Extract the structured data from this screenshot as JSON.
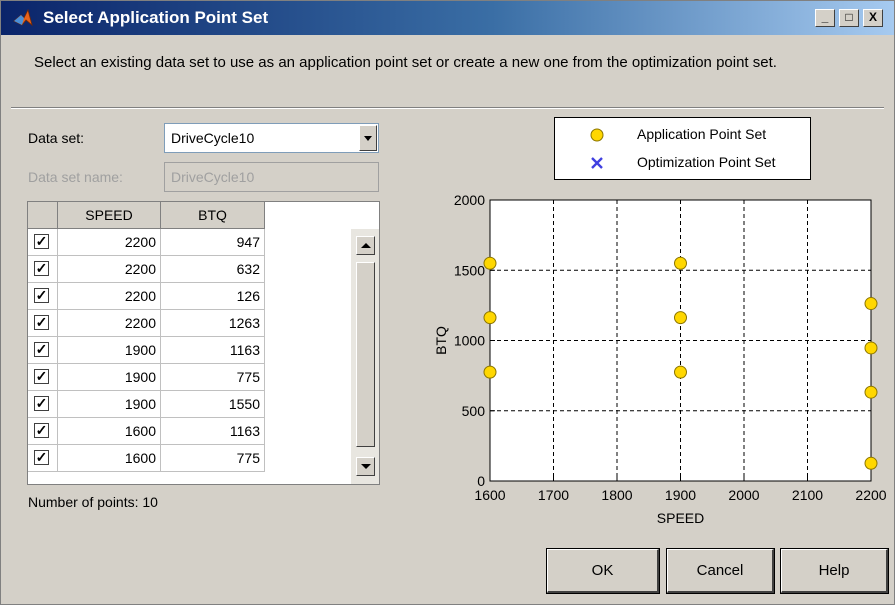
{
  "window": {
    "title": "Select Application Point Set",
    "minimize": "_",
    "maximize": "□",
    "close": "X"
  },
  "description": "Select an existing data set to use as an application point set or create a new one from the optimization point set.",
  "form": {
    "data_set_label": "Data set:",
    "data_set_value": "DriveCycle10",
    "name_label": "Data set name:",
    "name_value": "DriveCycle10"
  },
  "table": {
    "columns": [
      "SPEED",
      "BTQ"
    ],
    "rows": [
      {
        "checked": true,
        "speed": "2200",
        "btq": "947"
      },
      {
        "checked": true,
        "speed": "2200",
        "btq": "632"
      },
      {
        "checked": true,
        "speed": "2200",
        "btq": "126"
      },
      {
        "checked": true,
        "speed": "2200",
        "btq": "1263"
      },
      {
        "checked": true,
        "speed": "1900",
        "btq": "1163"
      },
      {
        "checked": true,
        "speed": "1900",
        "btq": "775"
      },
      {
        "checked": true,
        "speed": "1900",
        "btq": "1550"
      },
      {
        "checked": true,
        "speed": "1600",
        "btq": "1163"
      },
      {
        "checked": true,
        "speed": "1600",
        "btq": "775"
      }
    ]
  },
  "num_points": "Number of points: 10",
  "colors": {
    "marker_fill": "#ffd700",
    "marker_stroke": "#8b7500",
    "cross": "#4040e0"
  },
  "chart_data": {
    "type": "scatter",
    "xlabel": "SPEED",
    "ylabel": "BTQ",
    "xlim": [
      1600,
      2200
    ],
    "ylim": [
      0,
      2000
    ],
    "xticks": [
      1600,
      1700,
      1800,
      1900,
      2000,
      2100,
      2200
    ],
    "yticks": [
      0,
      500,
      1000,
      1500,
      2000
    ],
    "grid": true,
    "legend_position": "top",
    "series": [
      {
        "name": "Application Point Set",
        "points": [
          [
            1600,
            1550
          ],
          [
            1600,
            1163
          ],
          [
            1600,
            775
          ],
          [
            1900,
            1550
          ],
          [
            1900,
            1163
          ],
          [
            1900,
            775
          ],
          [
            2200,
            1263
          ],
          [
            2200,
            947
          ],
          [
            2200,
            632
          ],
          [
            2200,
            126
          ]
        ]
      },
      {
        "name": "Optimization Point Set",
        "points": []
      }
    ]
  },
  "buttons": {
    "ok": "OK",
    "cancel": "Cancel",
    "help": "Help"
  }
}
